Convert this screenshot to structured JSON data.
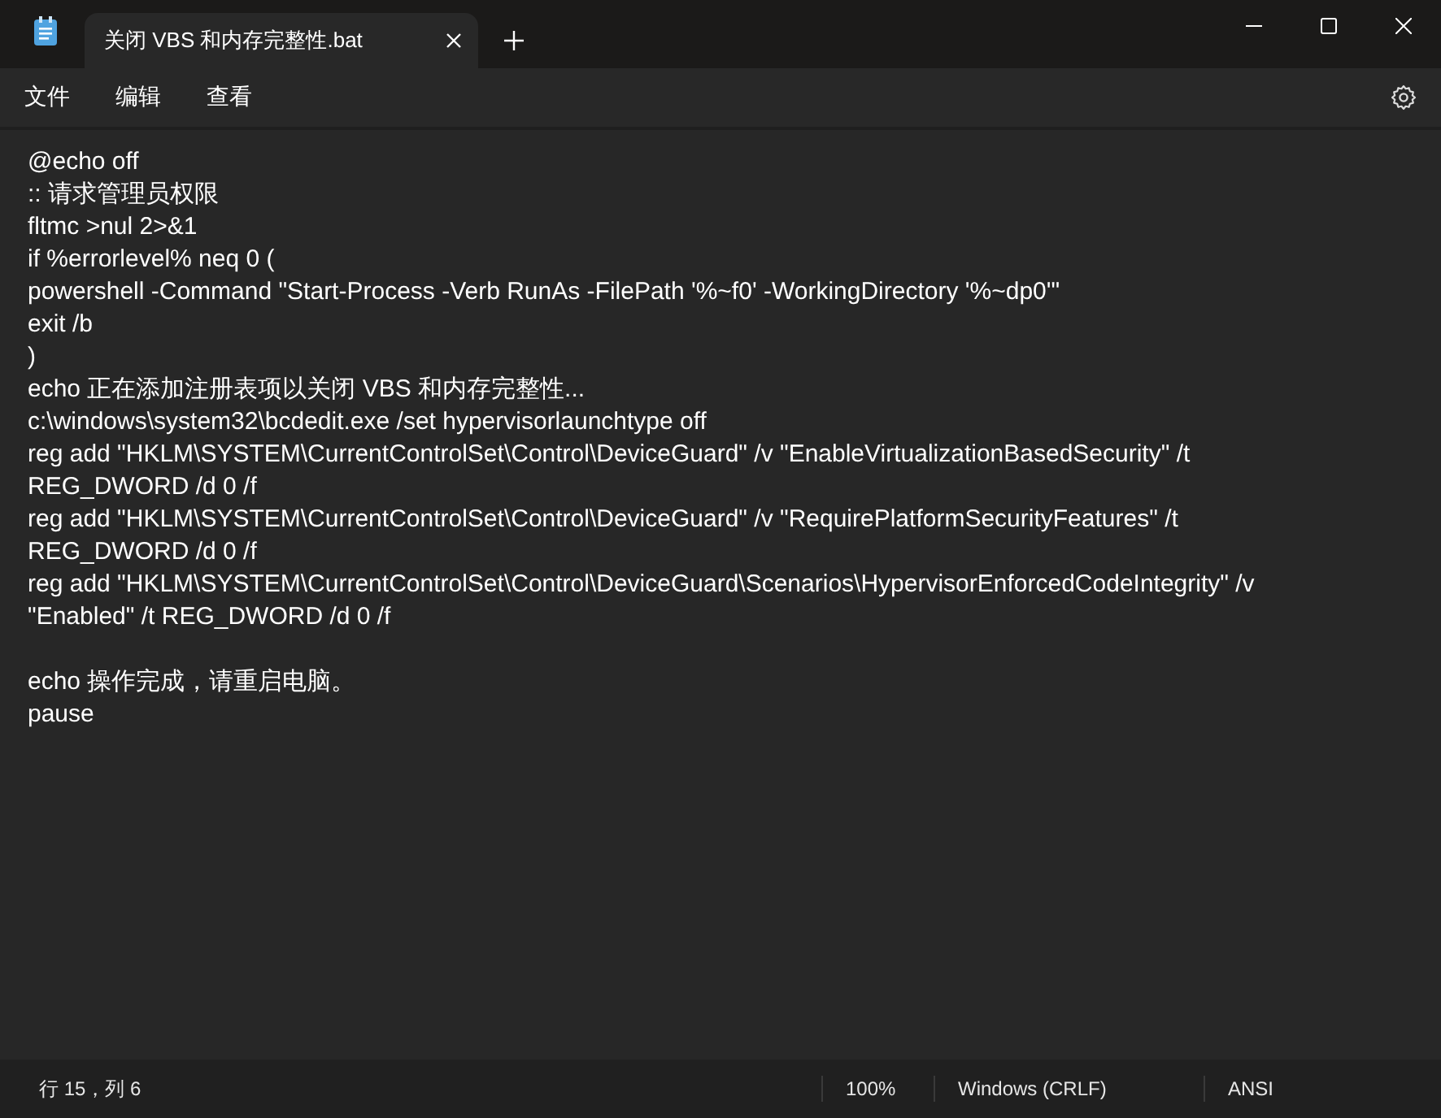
{
  "tabs": [
    {
      "title": "关闭 VBS 和内存完整性.bat",
      "selected": true
    }
  ],
  "menu": [
    "文件",
    "编辑",
    "查看"
  ],
  "editor": {
    "blocks": [
      [
        "@echo off",
        ":: 请求管理员权限",
        "fltmc >nul 2>&1",
        "if %errorlevel% neq 0 (",
        "powershell -Command \"Start-Process -Verb RunAs -FilePath '%~f0' -WorkingDirectory '%~dp0'\"",
        "exit /b",
        ")",
        "echo 正在添加注册表项以关闭 VBS 和内存完整性...",
        "c:\\windows\\system32\\bcdedit.exe /set hypervisorlaunchtype off",
        "reg add \"HKLM\\SYSTEM\\CurrentControlSet\\Control\\DeviceGuard\" /v \"EnableVirtualizationBasedSecurity\" /t",
        "REG_DWORD /d 0 /f",
        "reg add \"HKLM\\SYSTEM\\CurrentControlSet\\Control\\DeviceGuard\" /v \"RequirePlatformSecurityFeatures\" /t",
        "REG_DWORD /d 0 /f",
        "reg add \"HKLM\\SYSTEM\\CurrentControlSet\\Control\\DeviceGuard\\Scenarios\\HypervisorEnforcedCodeIntegrity\" /v",
        "\"Enabled\" /t REG_DWORD /d 0 /f"
      ],
      [
        "echo 操作完成，请重启电脑。",
        "pause"
      ]
    ]
  },
  "status_bar": {
    "position": "行 15，列 6",
    "zoom": "100%",
    "line_ending": "Windows (CRLF)",
    "encoding": "ANSI"
  }
}
